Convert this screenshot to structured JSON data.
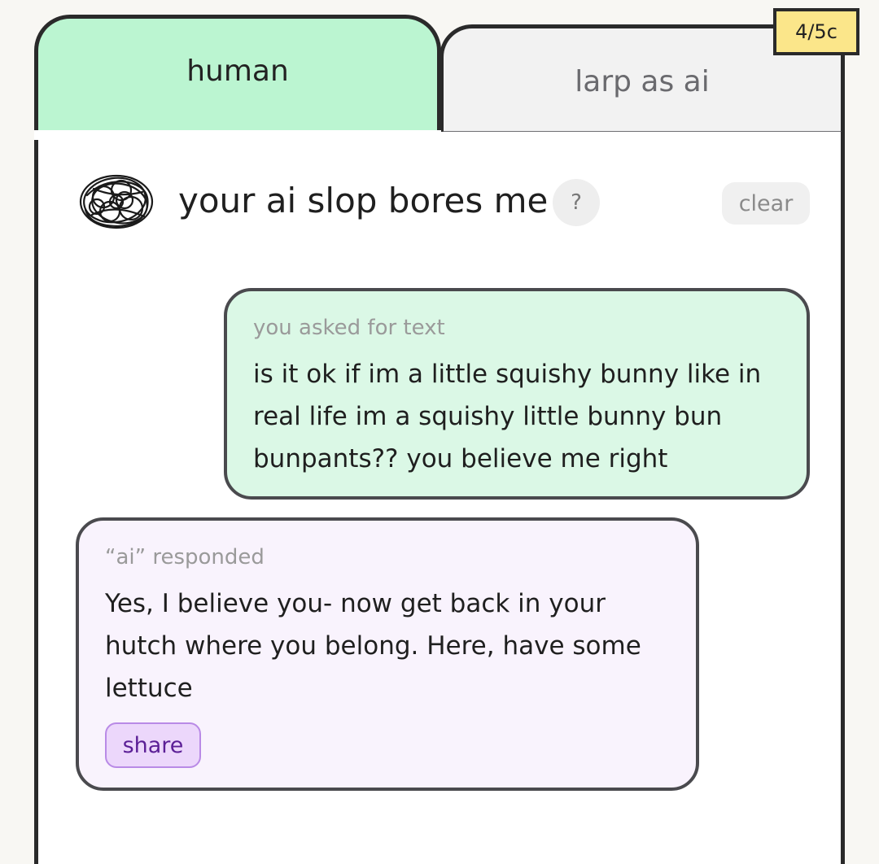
{
  "tabs": {
    "human_label": "human",
    "larp_label": "larp as ai"
  },
  "credits": "4/5c",
  "header": {
    "title": "your ai slop bores me",
    "help_label": "?",
    "clear_label": "clear"
  },
  "messages": {
    "user": {
      "label": "you asked for text",
      "text": "is it ok if im a little squishy bunny like in real life im a squishy little bunny bun bunpants?? you believe me right"
    },
    "ai": {
      "label": "“ai” responded",
      "text": "Yes, I believe you- now get back in your hutch where you belong. Here, have some lettuce",
      "share_label": "share"
    }
  },
  "colors": {
    "human_tab": "#bbf5d1",
    "larp_tab": "#f2f2f2",
    "credits_badge": "#fbe68a",
    "user_bubble": "#dbf8e6",
    "ai_bubble": "#f9f3fd",
    "share_button": "#ecd7fb"
  },
  "icons": {
    "avatar": "scribble-avatar-icon"
  }
}
